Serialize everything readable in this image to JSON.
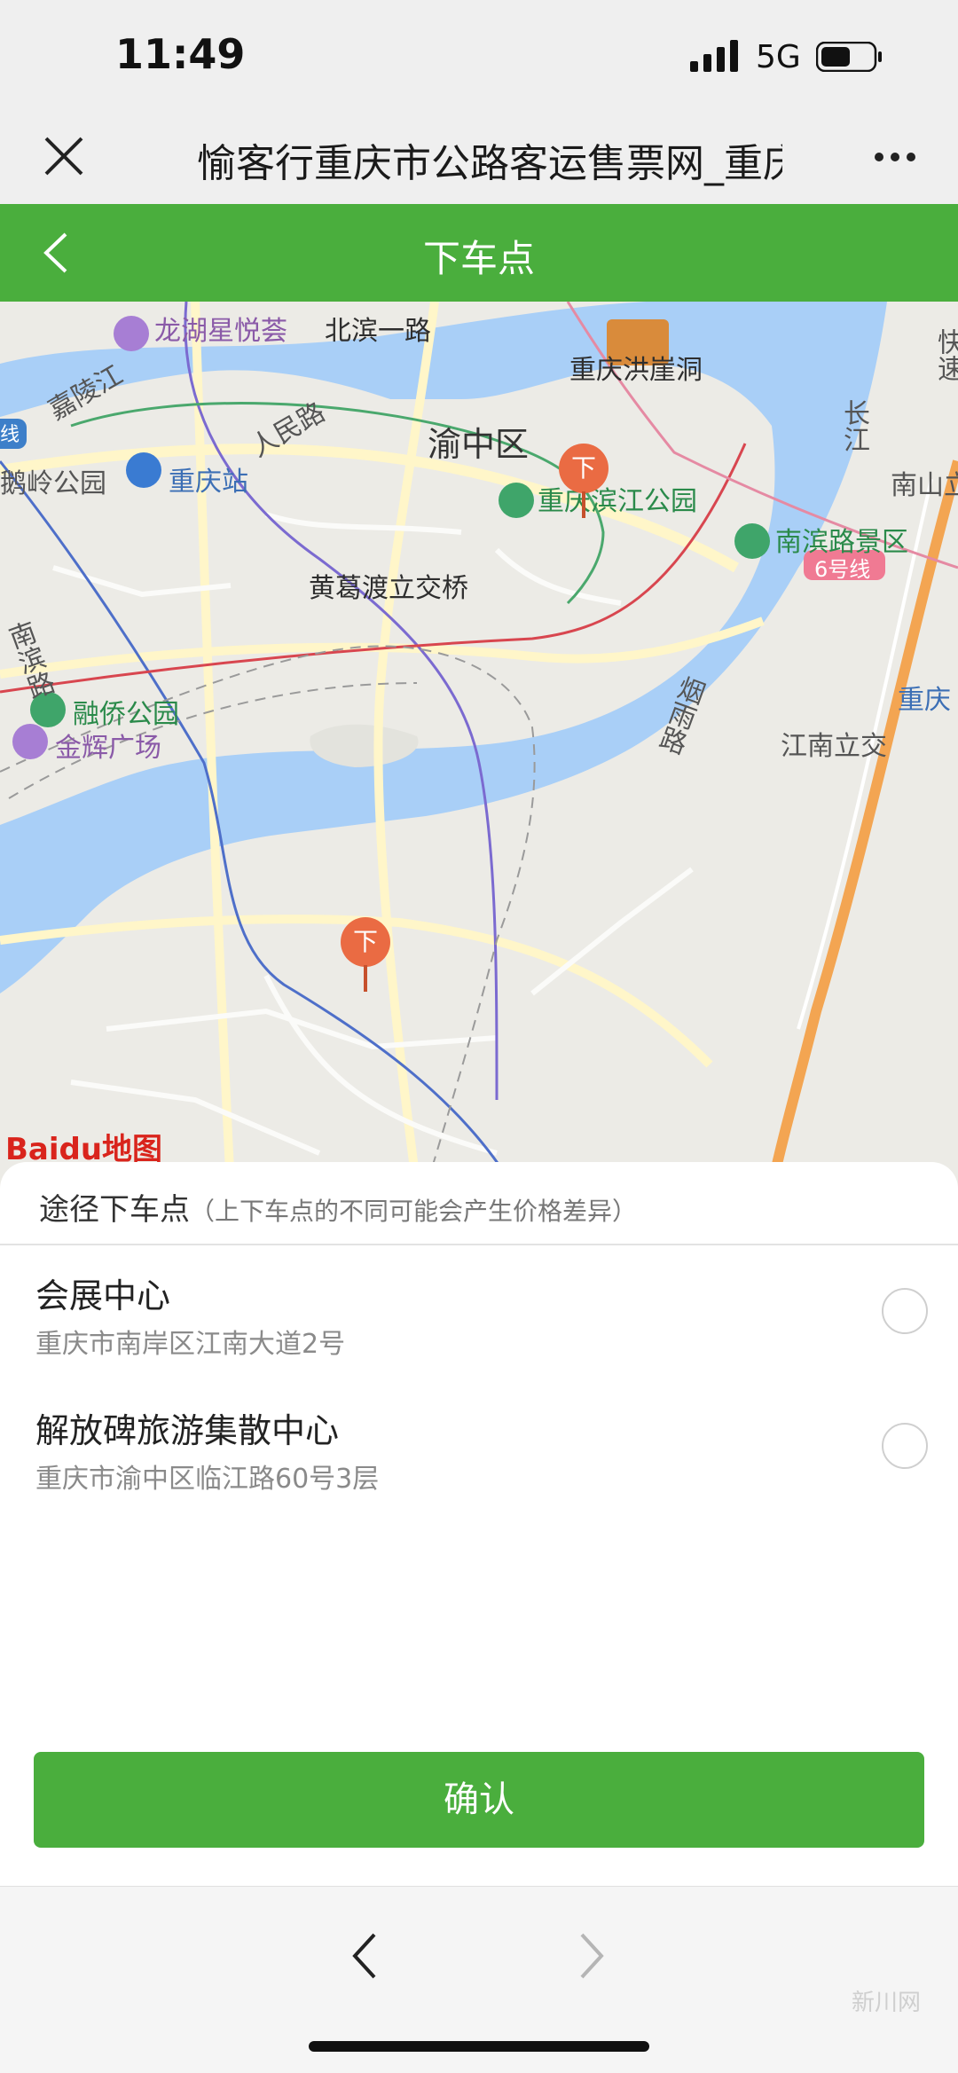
{
  "status_bar": {
    "time": "11:49",
    "network": "5G"
  },
  "wechat_header": {
    "title": "愉客行重庆市公路客运售票网_重庆"
  },
  "page": {
    "title": "下车点"
  },
  "map": {
    "labels": {
      "longhu": "龙湖星悦荟",
      "beibin": "北滨一路",
      "jialing": "嘉陵江",
      "renmin": "人民路",
      "hongya": "重庆洪崖洞",
      "changjiang": "长江",
      "line6": "6号线",
      "yuzhong": "渝中区",
      "eling": "鹅岭公园",
      "cq_station": "重庆站",
      "binjiang": "重庆滨江公园",
      "nanshan": "南山立",
      "nanbin": "南滨路景区",
      "huangge": "黄葛渡立交桥",
      "nanbin_road": "南滨路",
      "rongqiao": "融侨公园",
      "jinhui": "金辉广场",
      "yanyu": "烟雨路",
      "jiangnan": "江南立交",
      "chongqing_right": "重庆",
      "xian": "线",
      "kuaisu": "快速"
    },
    "pin_label": "下",
    "baidu_logo": "Baidu地图"
  },
  "panel": {
    "header": "途径下车点",
    "note": "（上下车点的不同可能会产生价格差异）",
    "stops": [
      {
        "name": "会展中心",
        "address": "重庆市南岸区江南大道2号"
      },
      {
        "name": "解放碑旅游集散中心",
        "address": "重庆市渝中区临江路60号3层"
      }
    ],
    "confirm_label": "确认"
  },
  "watermark": "新川网",
  "colors": {
    "accent": "#4aae3d",
    "pin": "#ea6b43"
  }
}
